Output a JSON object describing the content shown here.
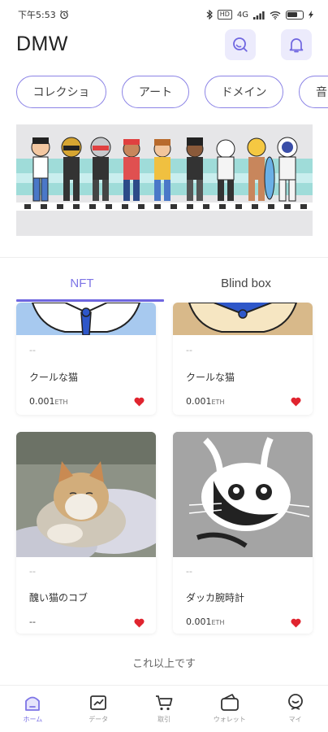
{
  "status_bar": {
    "time": "下午5:53",
    "hd_badge": "HD",
    "signal": "4G"
  },
  "header": {
    "title": "DMW"
  },
  "chips": [
    "コレクショ",
    "アート",
    "ドメイン",
    "音"
  ],
  "tabs": [
    {
      "label": "NFT",
      "active": true
    },
    {
      "label": "Blind  box",
      "active": false
    }
  ],
  "cards": [
    {
      "dash": "--",
      "name": "クールな猫",
      "price": "0.001",
      "unit": "ETH",
      "liked": true
    },
    {
      "dash": "--",
      "name": "クールな猫",
      "price": "0.001",
      "unit": "ETH",
      "liked": true
    },
    {
      "dash": "--",
      "name": "醜い猫のコブ",
      "price": "--",
      "unit": "",
      "liked": true
    },
    {
      "dash": "--",
      "name": "ダッカ腕時計",
      "price": "0.001",
      "unit": "ETH",
      "liked": true
    }
  ],
  "end_text": "これ以上です",
  "bottom_nav": [
    {
      "label": "ホーム",
      "icon": "home-icon",
      "active": true
    },
    {
      "label": "データ",
      "icon": "chart-icon",
      "active": false
    },
    {
      "label": "取引",
      "icon": "cart-icon",
      "active": false
    },
    {
      "label": "ウォレット",
      "icon": "wallet-icon",
      "active": false
    },
    {
      "label": "マイ",
      "icon": "profile-icon",
      "active": false
    }
  ],
  "colors": {
    "accent": "#7d74e6",
    "chip_border": "#8c84e6",
    "icon_bg": "#ecebfc",
    "heart": "#e0242f"
  }
}
